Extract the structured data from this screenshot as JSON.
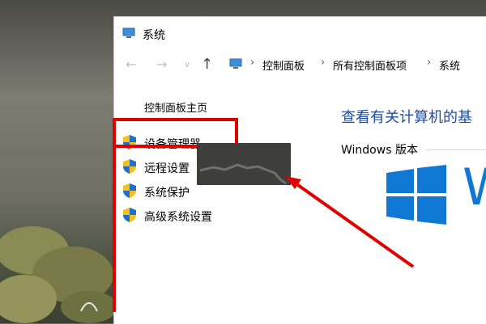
{
  "window": {
    "title": "系统"
  },
  "address_bar": {
    "crumbs": [
      "控制面板",
      "所有控制面板项",
      "系统"
    ]
  },
  "left_pane": {
    "home_link": "控制面板主页",
    "items": [
      {
        "label": "设备管理器",
        "icon": "uac-shield-icon"
      },
      {
        "label": "远程设置",
        "icon": "uac-shield-icon"
      },
      {
        "label": "系统保护",
        "icon": "uac-shield-icon"
      },
      {
        "label": "高级系统设置",
        "icon": "uac-shield-icon"
      }
    ]
  },
  "main": {
    "heading": "查看有关计算机的基",
    "edition_label": "Windows 版本",
    "logo_letter": "W"
  },
  "colors": {
    "accent_blue": "#1e4c9f",
    "windows_blue": "#0f78d4",
    "annotation_red": "#e00000"
  }
}
